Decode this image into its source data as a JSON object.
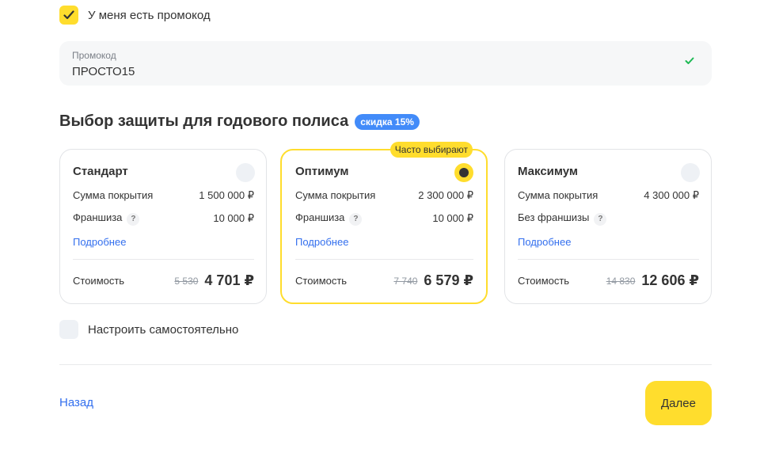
{
  "promo_checkbox": {
    "label": "У меня есть промокод",
    "checked": true
  },
  "promo_field": {
    "label": "Промокод",
    "value": "ПРОСТО15"
  },
  "section": {
    "title": "Выбор защиты для годового полиса",
    "discount_badge": "скидка 15%"
  },
  "cards": [
    {
      "title": "Стандарт",
      "selected": false,
      "coverage_label": "Сумма покрытия",
      "coverage_value": "1 500 000 ₽",
      "franchise_label": "Франшиза",
      "franchise_value": "10 000 ₽",
      "help": "?",
      "more_link": "Подробнее",
      "cost_label": "Стоимость",
      "old_price": "5 530",
      "new_price": "4 701 ₽"
    },
    {
      "title": "Оптимум",
      "selected": true,
      "badge": "Часто выбирают",
      "coverage_label": "Сумма покрытия",
      "coverage_value": "2 300 000 ₽",
      "franchise_label": "Франшиза",
      "franchise_value": "10 000 ₽",
      "help": "?",
      "more_link": "Подробнее",
      "cost_label": "Стоимость",
      "old_price": "7 740",
      "new_price": "6 579 ₽"
    },
    {
      "title": "Максимум",
      "selected": false,
      "coverage_label": "Сумма покрытия",
      "coverage_value": "4 300 000 ₽",
      "franchise_label": "Без франшизы",
      "franchise_value": "",
      "help": "?",
      "more_link": "Подробнее",
      "cost_label": "Стоимость",
      "old_price": "14 830",
      "new_price": "12 606 ₽"
    }
  ],
  "custom_checkbox": {
    "label": "Настроить самостоятельно",
    "checked": false
  },
  "footer": {
    "back_label": "Назад",
    "next_label": "Далее"
  },
  "colors": {
    "accent_yellow": "#ffdd2d",
    "link_blue": "#336fee",
    "badge_blue": "#428bf9",
    "check_green": "#1db954"
  },
  "icons": {
    "promo_check": "checkmark-icon",
    "promo_valid": "valid-check-icon"
  }
}
